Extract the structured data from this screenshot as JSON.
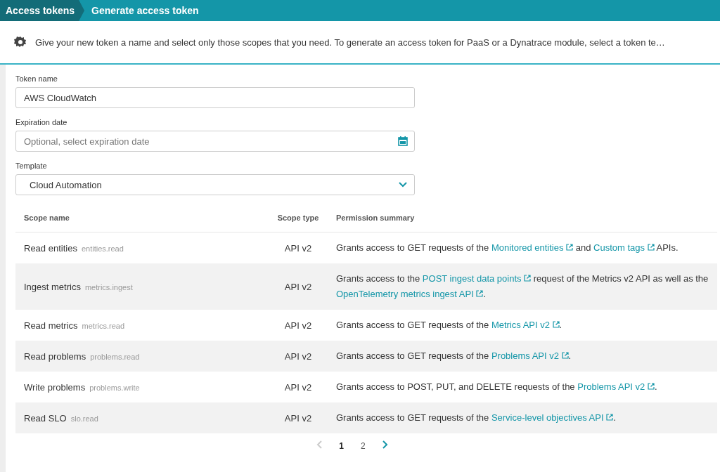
{
  "breadcrumb": [
    {
      "label": "Access tokens",
      "selected": false
    },
    {
      "label": "Generate access token",
      "selected": true
    }
  ],
  "info": "Give your new token a name and select only those scopes that you need. To generate an access token for PaaS or a Dynatrace module, select a token te…",
  "form": {
    "token_name": {
      "label": "Token name",
      "value": "AWS CloudWatch"
    },
    "expiration": {
      "label": "Expiration date",
      "placeholder": "Optional, select expiration date"
    },
    "template": {
      "label": "Template",
      "value": "Cloud Automation"
    }
  },
  "table": {
    "columns": [
      "Scope name",
      "Scope type",
      "Permission summary"
    ],
    "rows": [
      {
        "name": "Read entities",
        "scope": "entities.read",
        "type": "API v2",
        "summary": [
          {
            "kind": "text",
            "text": "Grants access to GET requests of the "
          },
          {
            "kind": "link",
            "text": "Monitored entities"
          },
          {
            "kind": "text",
            "text": " and "
          },
          {
            "kind": "link",
            "text": "Custom tags"
          },
          {
            "kind": "text",
            "text": " APIs."
          }
        ]
      },
      {
        "name": "Ingest metrics",
        "scope": "metrics.ingest",
        "type": "API v2",
        "summary": [
          {
            "kind": "text",
            "text": "Grants access to the "
          },
          {
            "kind": "link",
            "text": "POST ingest data points"
          },
          {
            "kind": "text",
            "text": " request of the Metrics v2 API as well as the "
          },
          {
            "kind": "link",
            "text": "OpenTelemetry metrics ingest API"
          },
          {
            "kind": "text",
            "text": "."
          }
        ]
      },
      {
        "name": "Read metrics",
        "scope": "metrics.read",
        "type": "API v2",
        "summary": [
          {
            "kind": "text",
            "text": "Grants access to GET requests of the "
          },
          {
            "kind": "link",
            "text": "Metrics API v2"
          },
          {
            "kind": "text",
            "text": "."
          }
        ]
      },
      {
        "name": "Read problems",
        "scope": "problems.read",
        "type": "API v2",
        "summary": [
          {
            "kind": "text",
            "text": "Grants access to GET requests of the "
          },
          {
            "kind": "link",
            "text": "Problems API v2"
          },
          {
            "kind": "text",
            "text": "."
          }
        ]
      },
      {
        "name": "Write problems",
        "scope": "problems.write",
        "type": "API v2",
        "summary": [
          {
            "kind": "text",
            "text": "Grants access to POST, PUT, and DELETE requests of the "
          },
          {
            "kind": "link",
            "text": "Problems API v2"
          },
          {
            "kind": "text",
            "text": "."
          }
        ]
      },
      {
        "name": "Read SLO",
        "scope": "slo.read",
        "type": "API v2",
        "summary": [
          {
            "kind": "text",
            "text": "Grants access to GET requests of the "
          },
          {
            "kind": "link",
            "text": "Service-level objectives API"
          },
          {
            "kind": "text",
            "text": "."
          }
        ]
      }
    ]
  },
  "pagination": {
    "prev_disabled": true,
    "next_disabled": false,
    "pages": [
      {
        "label": "1",
        "selected": true
      },
      {
        "label": "2",
        "selected": false
      }
    ]
  }
}
